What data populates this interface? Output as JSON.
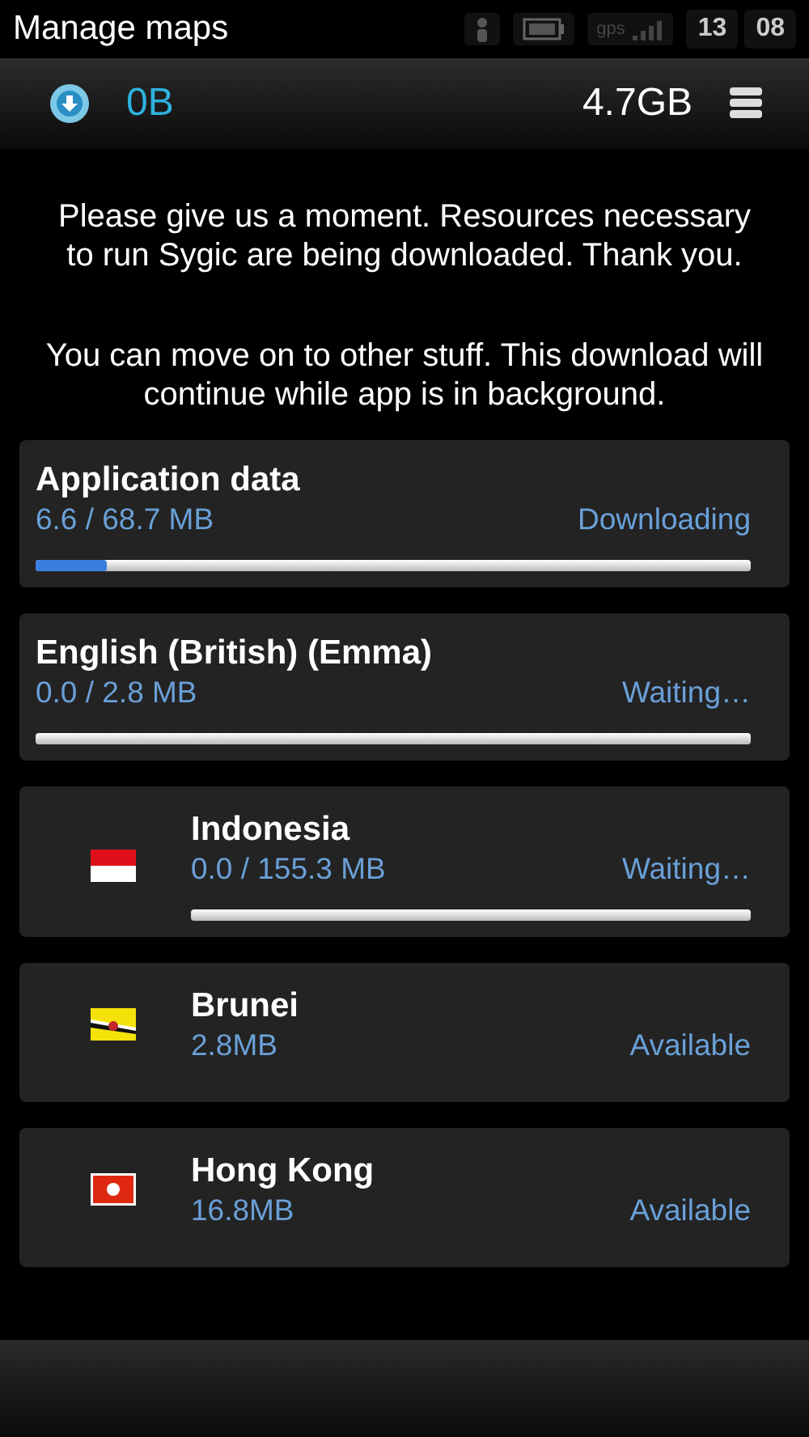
{
  "status_bar": {
    "title": "Manage maps",
    "gps_label": "gps",
    "hour": "13",
    "minute": "08"
  },
  "header": {
    "downloaded": "0B",
    "free_space": "4.7GB"
  },
  "messages": [
    "Please give us a moment. Resources necessary to run Sygic are being downloaded. Thank you.",
    "You can move on to other stuff. This download will continue while app is in background."
  ],
  "items": [
    {
      "kind": "resource",
      "name": "Application data",
      "size": "6.6 / 68.7 MB",
      "status": "Downloading",
      "level": 0.1
    },
    {
      "kind": "resource",
      "name": "English (British) (Emma)",
      "size": "0.0 / 2.8 MB",
      "status": "Waiting…",
      "level": 0
    },
    {
      "kind": "map",
      "name": "Indonesia",
      "size": "0.0 / 155.3 MB",
      "status": "Waiting…",
      "level": 0
    },
    {
      "kind": "map",
      "name": "Brunei",
      "size": "2.8MB",
      "status": "Available"
    },
    {
      "kind": "map",
      "name": "Hong Kong",
      "size": "16.8MB",
      "status": "Available"
    }
  ]
}
